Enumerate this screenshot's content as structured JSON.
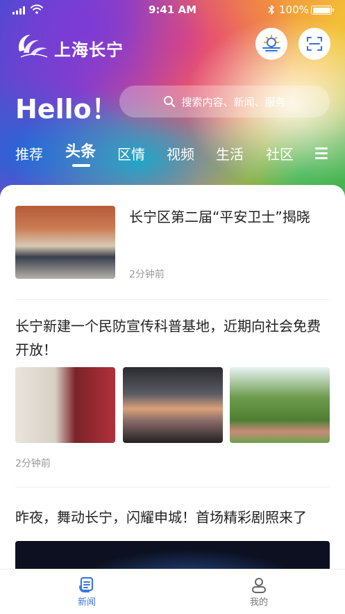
{
  "status_bar": {
    "time": "9:41 AM",
    "battery": "100%"
  },
  "header": {
    "app_title": "上海长宁",
    "greeting": "Hello！",
    "search_placeholder": "搜索内容、新闻、服务",
    "weather_icon": "weather-icon",
    "scan_icon": "scan-icon"
  },
  "tabs": [
    {
      "label": "推荐"
    },
    {
      "label": "头条",
      "active": true
    },
    {
      "label": "区情"
    },
    {
      "label": "视频"
    },
    {
      "label": "生活"
    },
    {
      "label": "社区"
    }
  ],
  "news": [
    {
      "title": "长宁区第二届“平安卫士”揭晓",
      "time": "2分钟前"
    },
    {
      "title": "长宁新建一个民防宣传科普基地，近期向社会免费开放！",
      "time": "2分钟前"
    },
    {
      "title": "昨夜，舞动长宁，闪耀申城！首场精彩剧照来了"
    }
  ],
  "bottom_nav": {
    "news": {
      "label": "新闻",
      "color": "#3a78e0"
    },
    "mine": {
      "label": "我的",
      "color": "#777777"
    }
  }
}
